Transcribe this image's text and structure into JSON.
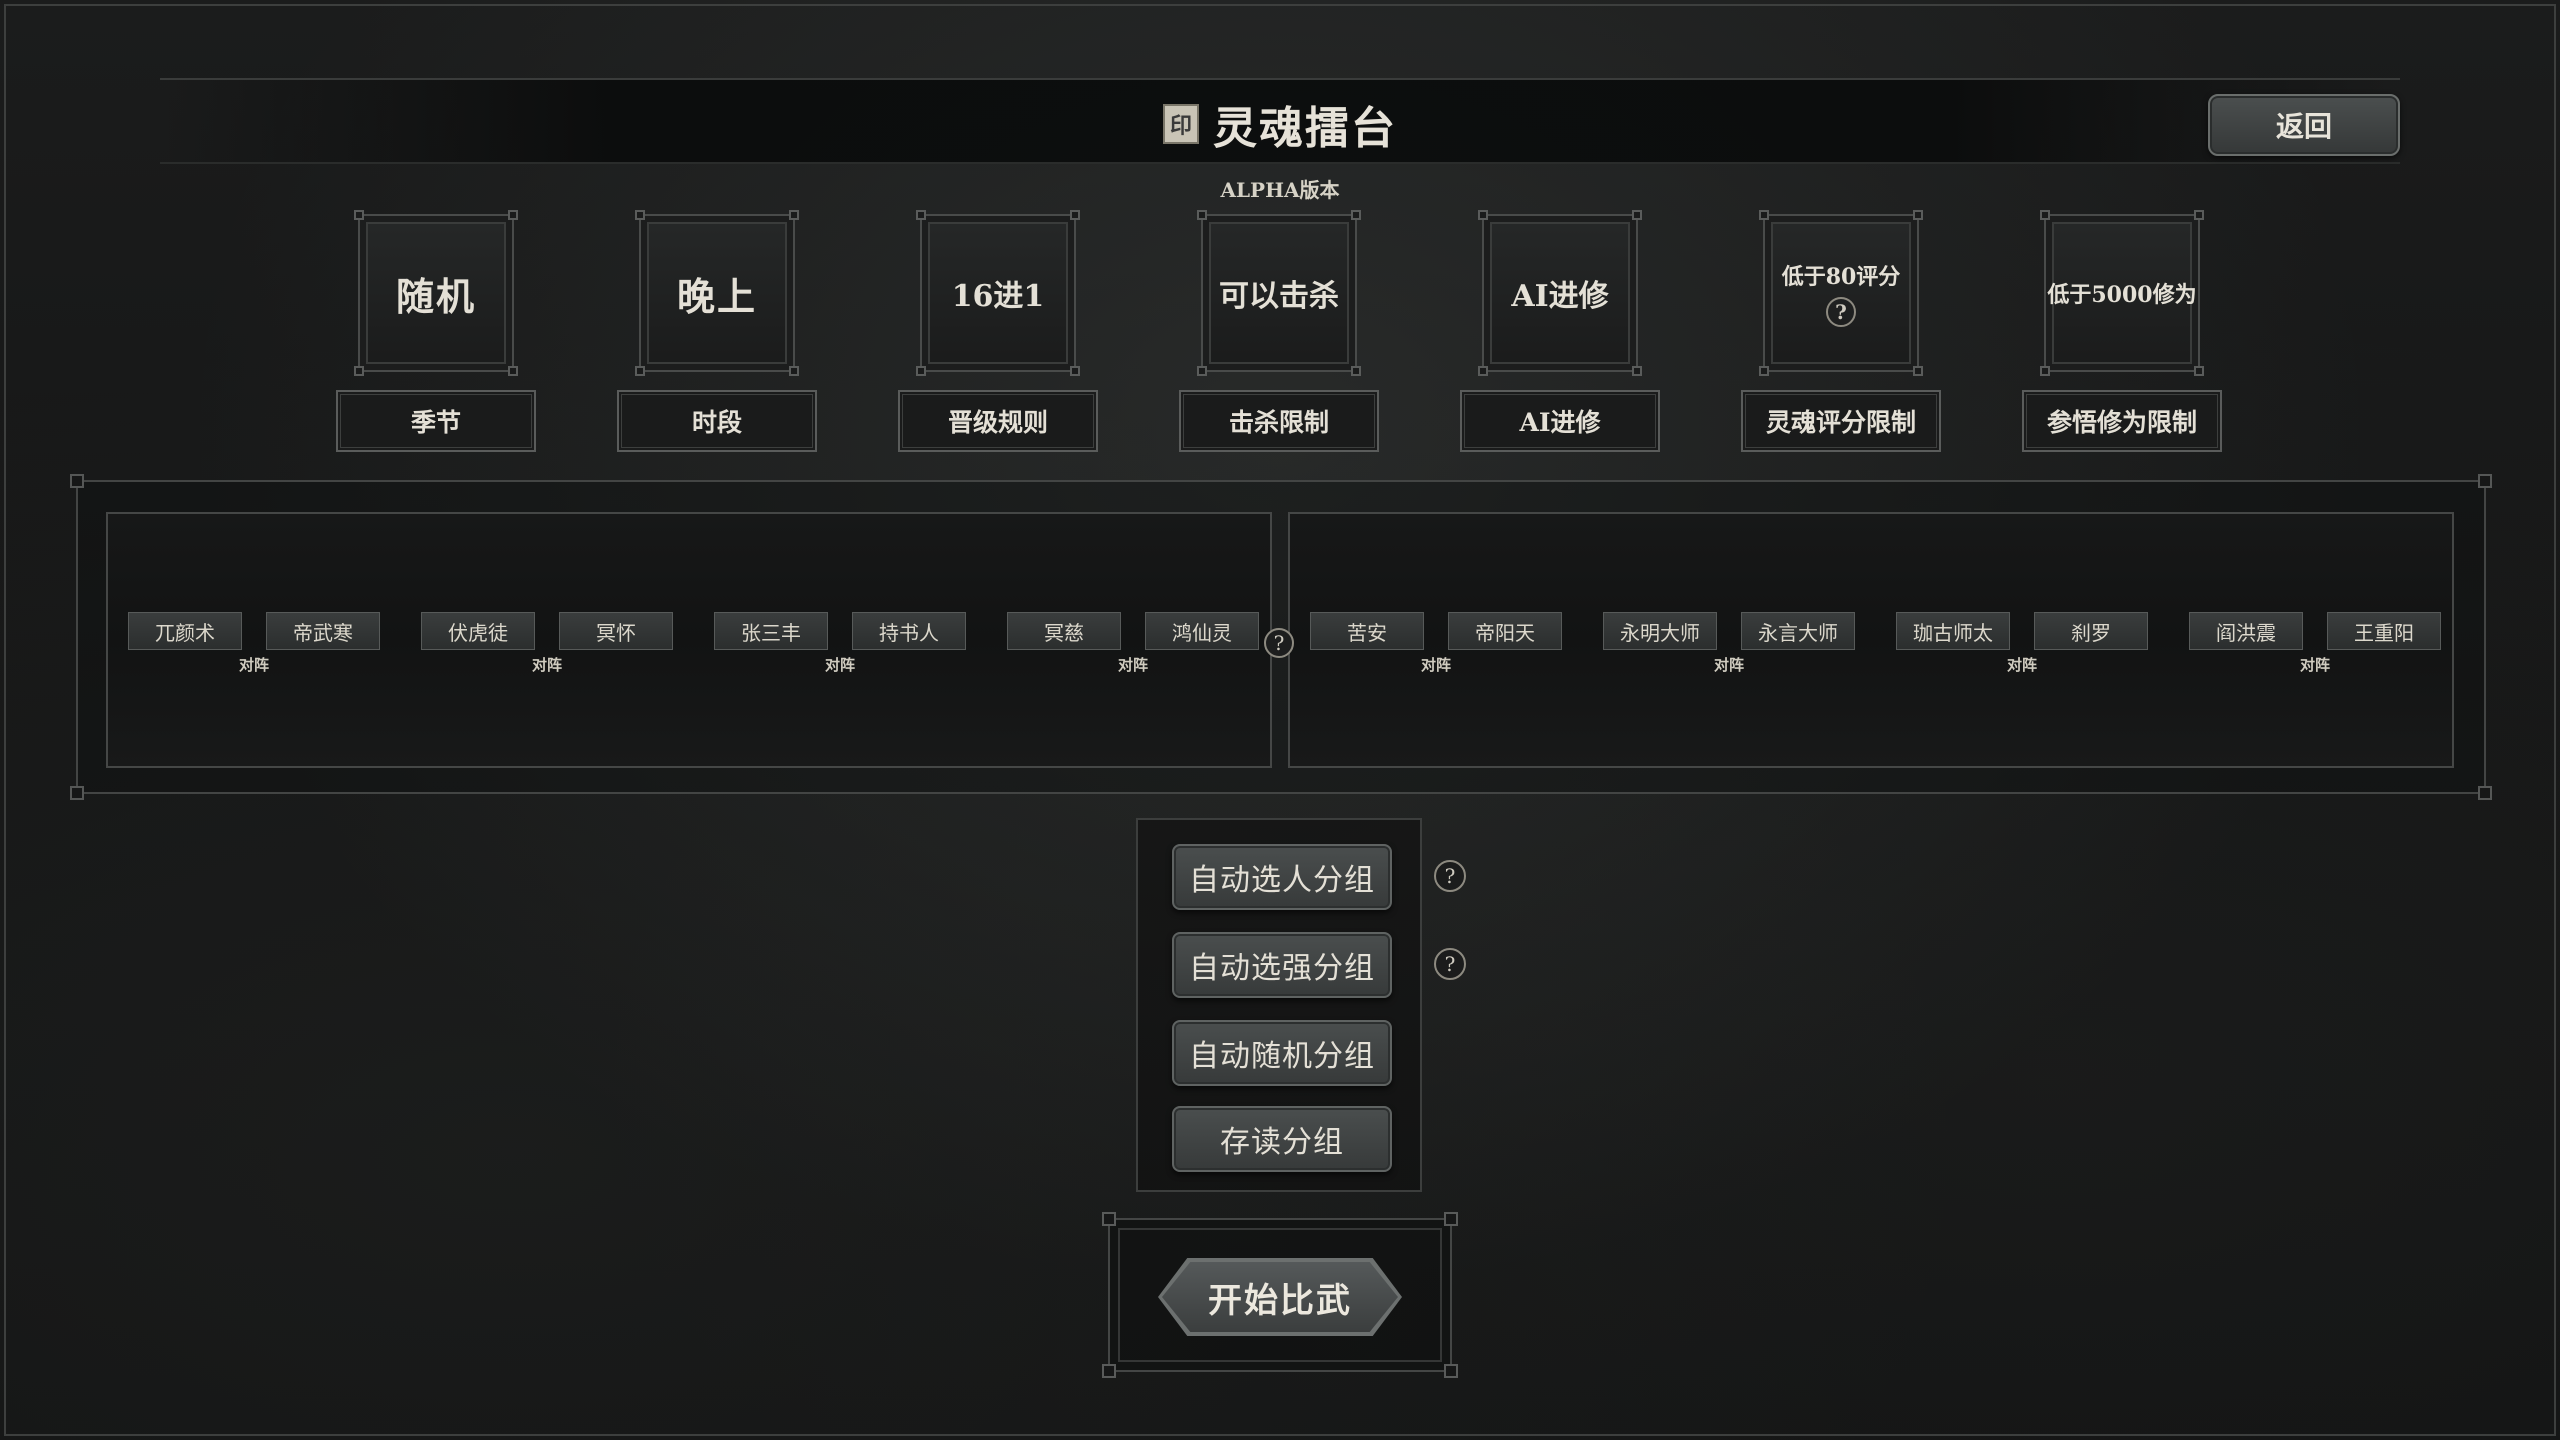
{
  "header": {
    "title": "灵魂擂台",
    "title_icon": "seal-icon",
    "subtitle": "ALPHA版本",
    "back_label": "返回"
  },
  "settings": [
    {
      "value": "随机",
      "label": "季节",
      "size": "lg"
    },
    {
      "value": "晚上",
      "label": "时段",
      "size": "lg"
    },
    {
      "value": "16进1",
      "label": "晋级规则",
      "size": "md"
    },
    {
      "value": "可以击杀",
      "label": "击杀限制",
      "size": "md"
    },
    {
      "value": "AI进修",
      "label": "AI进修",
      "size": "md"
    },
    {
      "value": "低于80评分",
      "label": "灵魂评分限制",
      "size": "sm",
      "has_help": true
    },
    {
      "value": "低于5000修为",
      "label": "参悟修为限制",
      "size": "sm"
    }
  ],
  "bracket": {
    "vs_label": "对阵",
    "center_help": "?",
    "left": [
      {
        "a": "兀颜术",
        "b": "帝武寒"
      },
      {
        "a": "伏虎徒",
        "b": "冥怀"
      },
      {
        "a": "张三丰",
        "b": "持书人"
      },
      {
        "a": "冥慈",
        "b": "鸿仙灵"
      }
    ],
    "right": [
      {
        "a": "苦安",
        "b": "帝阳天"
      },
      {
        "a": "永明大师",
        "b": "永言大师"
      },
      {
        "a": "珈古师太",
        "b": "刹罗"
      },
      {
        "a": "阎洪震",
        "b": "王重阳"
      }
    ]
  },
  "group_buttons": {
    "auto_select": "自动选人分组",
    "auto_strong": "自动选强分组",
    "auto_random": "自动随机分组",
    "save_load": "存读分组",
    "help": "?"
  },
  "start": {
    "label": "开始比武"
  }
}
